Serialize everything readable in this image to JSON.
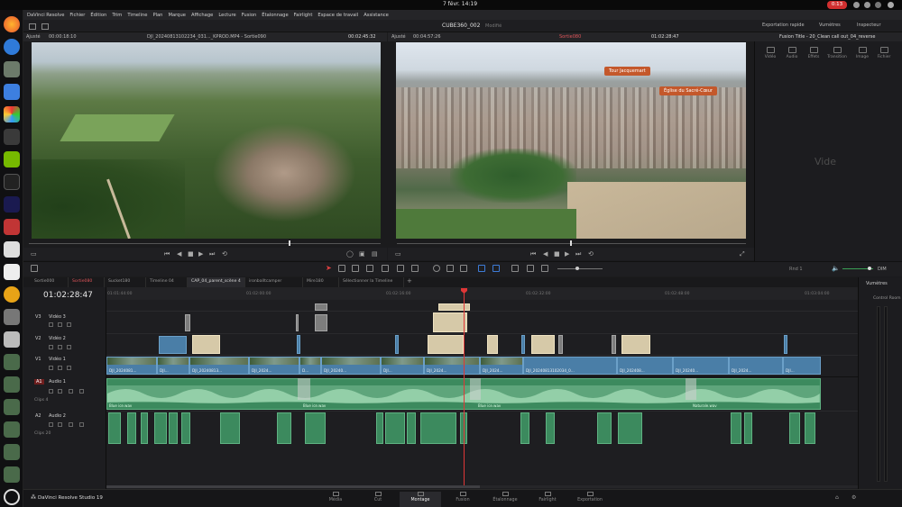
{
  "system": {
    "clock": "7 févr.  14:19",
    "recording": "0:13"
  },
  "menu": [
    "DaVinci Resolve",
    "Fichier",
    "Édition",
    "Trim",
    "Timeline",
    "Plan",
    "Marque",
    "Affichage",
    "Lecture",
    "Fusion",
    "Étalonnage",
    "Fairlight",
    "Espace de travail",
    "Assistance"
  ],
  "project": {
    "name": "CUBE360_002",
    "status": "Modifié",
    "right_buttons": [
      "Exportation rapide",
      "Vumètres",
      "Inspecteur"
    ]
  },
  "source_viewer": {
    "zoom": "Ajusté",
    "duration": "00:00:18:10",
    "clip": "DJI_20240813102234_031..._KPROD.MP4 - Sortie090",
    "timecode": "00:02:45:32"
  },
  "timeline_viewer": {
    "zoom": "Ajusté",
    "duration": "00:04:57:26",
    "name": "Sortie080",
    "timecode": "01:02:28:47",
    "annotations": [
      "Tour Jacquemart",
      "Église du Sacré-Cœur"
    ]
  },
  "inspector": {
    "title": "Fusion Title - 20_Clean call out_04_reverse",
    "tabs": [
      "Vidéo",
      "Audio",
      "Effets",
      "Transition",
      "Image",
      "Fichier"
    ],
    "empty_text": "Vide"
  },
  "timeline": {
    "timecode": "01:02:28:47",
    "tabs": [
      "Sortie000",
      "Sortie080",
      "Sucket180",
      "Timeline 04",
      "CAP_04_parent_scène 4",
      "ironballtcamper",
      "Mire180",
      "Sélectionner la Timeline"
    ],
    "ruler": [
      "01:01:44:00",
      "01:02:00:00",
      "01:02:16:00",
      "01:02:32:00",
      "01:02:48:00",
      "01:03:04:00",
      "01:03:20:00",
      "01:03:36:00"
    ],
    "tracks": [
      {
        "id": "V3",
        "name": "Vidéo 3"
      },
      {
        "id": "V2",
        "name": "Vidéo 2"
      },
      {
        "id": "V1",
        "name": "Vidéo 1"
      },
      {
        "id": "A1",
        "name": "Audio 1",
        "sub": "Clips 4"
      },
      {
        "id": "A2",
        "name": "Audio 2",
        "sub": "Clips 20"
      }
    ],
    "audio_labels": [
      "Blue ice.wav",
      "Blue ice.wav",
      "Blue ice.wav",
      "Naturale.wav"
    ],
    "zoom_label": "Rnd 1",
    "mute_label": "DIM"
  },
  "meters": {
    "title": "Vumètres",
    "control_room": "Control Room"
  },
  "pages": [
    "Média",
    "Cut",
    "Montage",
    "Fusion",
    "Étalonnage",
    "Fairlight",
    "Exportation"
  ],
  "brand": "DaVinci Resolve Studio 19",
  "colors": {
    "accent": "#e03737",
    "audio": "#3c8a5e",
    "video": "#4a7ea7",
    "title": "#d6c9a8"
  }
}
